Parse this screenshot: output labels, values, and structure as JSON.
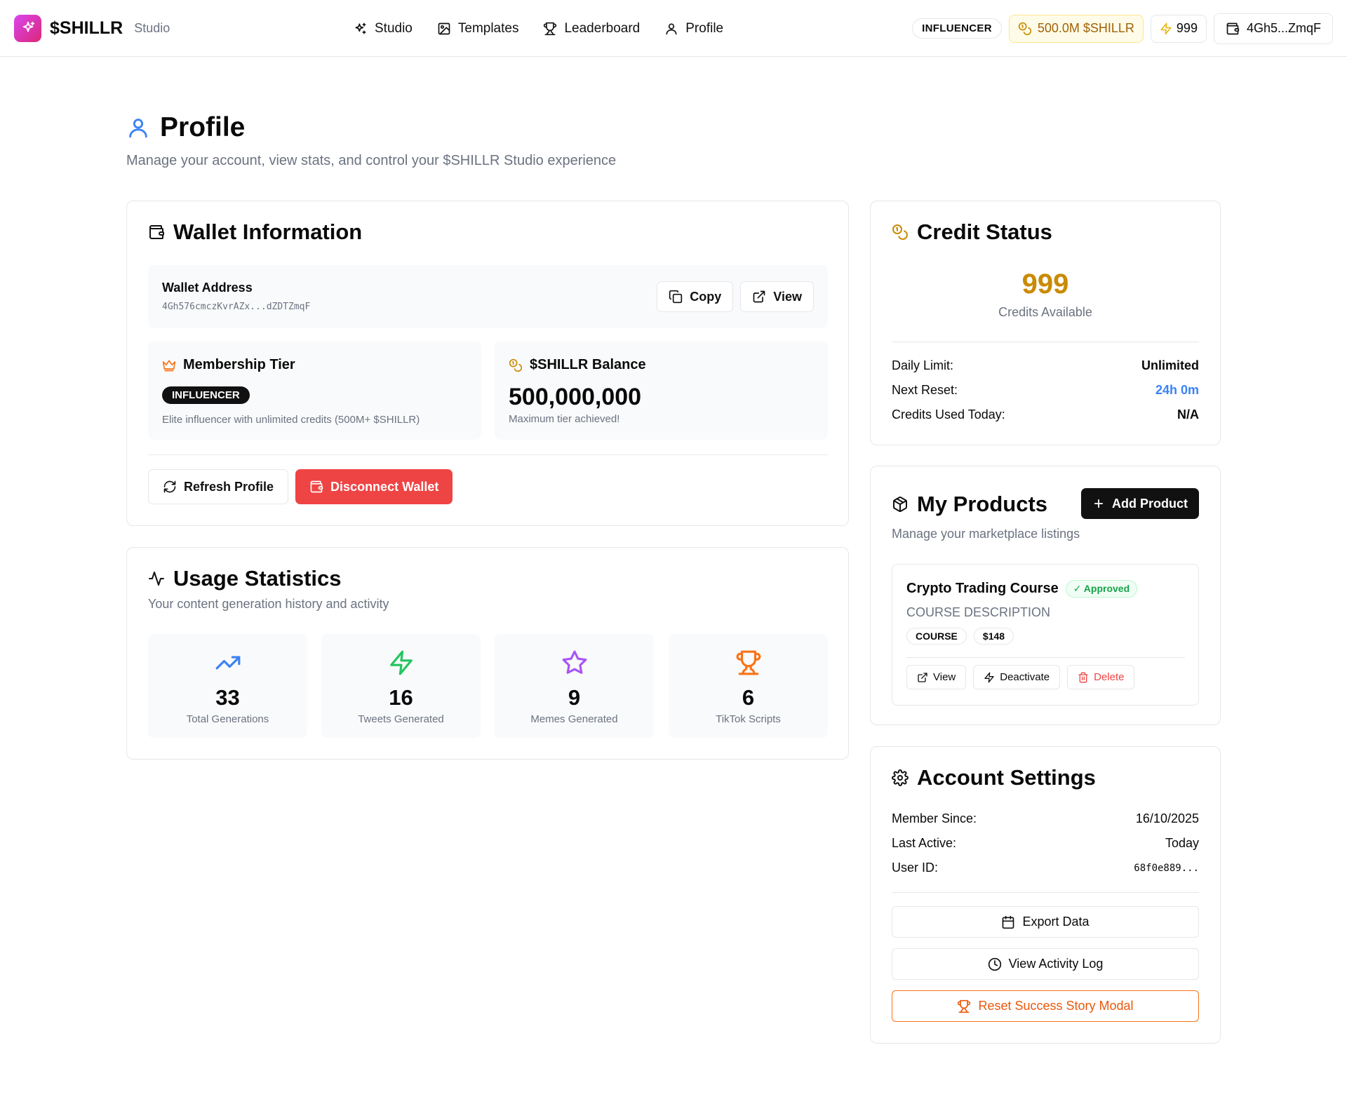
{
  "header": {
    "brand_name": "$SHILLR",
    "brand_sub": "Studio",
    "nav": [
      {
        "label": "Studio",
        "icon": "sparkles-icon"
      },
      {
        "label": "Templates",
        "icon": "image-icon"
      },
      {
        "label": "Leaderboard",
        "icon": "trophy-icon"
      },
      {
        "label": "Profile",
        "icon": "user-icon"
      }
    ],
    "tier_badge": "INFLUENCER",
    "balance": "500.0M $SHILLR",
    "credits": "999",
    "wallet_short": "4Gh5...ZmqF"
  },
  "page": {
    "title": "Profile",
    "description": "Manage your account, view stats, and control your $SHILLR Studio experience"
  },
  "wallet": {
    "title": "Wallet Information",
    "address_label": "Wallet Address",
    "address_value": "4Gh576cmczKvrAZx...dZDTZmqF",
    "copy_label": "Copy",
    "view_label": "View",
    "membership_title": "Membership Tier",
    "membership_badge": "INFLUENCER",
    "membership_note": "Elite influencer with unlimited credits (500M+ $SHILLR)",
    "balance_title": "$SHILLR Balance",
    "balance_value": "500,000,000",
    "balance_note": "Maximum tier achieved!",
    "refresh_label": "Refresh Profile",
    "disconnect_label": "Disconnect Wallet"
  },
  "usage": {
    "title": "Usage Statistics",
    "subtitle": "Your content generation history and activity",
    "stats": [
      {
        "value": "33",
        "label": "Total Generations",
        "icon": "trending-up-icon",
        "color": "#3b82f6"
      },
      {
        "value": "16",
        "label": "Tweets Generated",
        "icon": "zap-icon",
        "color": "#22c55e"
      },
      {
        "value": "9",
        "label": "Memes Generated",
        "icon": "star-icon",
        "color": "#a855f7"
      },
      {
        "value": "6",
        "label": "TikTok Scripts",
        "icon": "trophy-icon",
        "color": "#f97316"
      }
    ]
  },
  "credit": {
    "title": "Credit Status",
    "available_value": "999",
    "available_label": "Credits Available",
    "rows": [
      {
        "label": "Daily Limit:",
        "value": "Unlimited"
      },
      {
        "label": "Next Reset:",
        "value": "24h 0m"
      },
      {
        "label": "Credits Used Today:",
        "value": "N/A"
      }
    ]
  },
  "products": {
    "title": "My Products",
    "add_label": "Add Product",
    "subtitle": "Manage your marketplace listings",
    "items": [
      {
        "name": "Crypto Trading Course",
        "status": "✓ Approved",
        "description": "COURSE DESCRIPTION",
        "category": "COURSE",
        "price": "$148",
        "view_label": "View",
        "deactivate_label": "Deactivate",
        "delete_label": "Delete"
      }
    ]
  },
  "settings": {
    "title": "Account Settings",
    "rows": [
      {
        "label": "Member Since:",
        "value": "16/10/2025"
      },
      {
        "label": "Last Active:",
        "value": "Today"
      },
      {
        "label": "User ID:",
        "value": "68f0e889..."
      }
    ],
    "export_label": "Export Data",
    "activity_label": "View Activity Log",
    "reset_label": "Reset Success Story Modal"
  },
  "colors": {
    "accent_blue": "#3b82f6",
    "gold": "#ca8a04",
    "danger": "#ef4444",
    "warning_orange": "#ea580c",
    "approved_green": "#16a34a"
  }
}
